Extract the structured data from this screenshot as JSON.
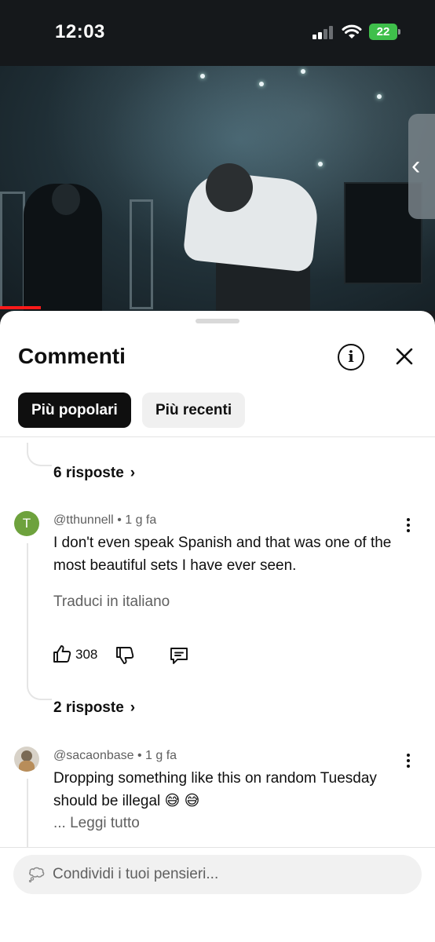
{
  "status_bar": {
    "time": "12:03",
    "battery": "22"
  },
  "video": {
    "progress_fraction": 0.094
  },
  "sheet": {
    "title": "Commenti",
    "filters": [
      {
        "label": "Più popolari",
        "active": true
      },
      {
        "label": "Più recenti",
        "active": false
      }
    ]
  },
  "thread_top": {
    "replies_label": "6 risposte"
  },
  "comments": [
    {
      "avatar_letter": "T",
      "avatar_color": "#6ea23d",
      "author": "@tthunnell",
      "time": "• 1 g fa",
      "text": "I don't even speak Spanish and that was one of the most beautiful sets I have ever seen.",
      "translate_label": "Traduci in italiano",
      "likes": "308",
      "replies_label": "2 risposte"
    },
    {
      "author": "@sacaonbase",
      "time": "• 1 g fa",
      "text": "Dropping something like this on random Tuesday should be illegal 😅 😅",
      "read_more": "... Leggi tutto"
    }
  ],
  "composer": {
    "placeholder": "Condividi i tuoi pensieri..."
  },
  "icons": [
    "signal-icon",
    "wifi-icon",
    "battery-icon",
    "info-icon",
    "close-icon",
    "chevron-right-icon",
    "more-vertical-icon",
    "thumb-up-icon",
    "thumb-down-icon",
    "reply-icon",
    "thought-bubble-icon",
    "chevron-left-icon"
  ]
}
